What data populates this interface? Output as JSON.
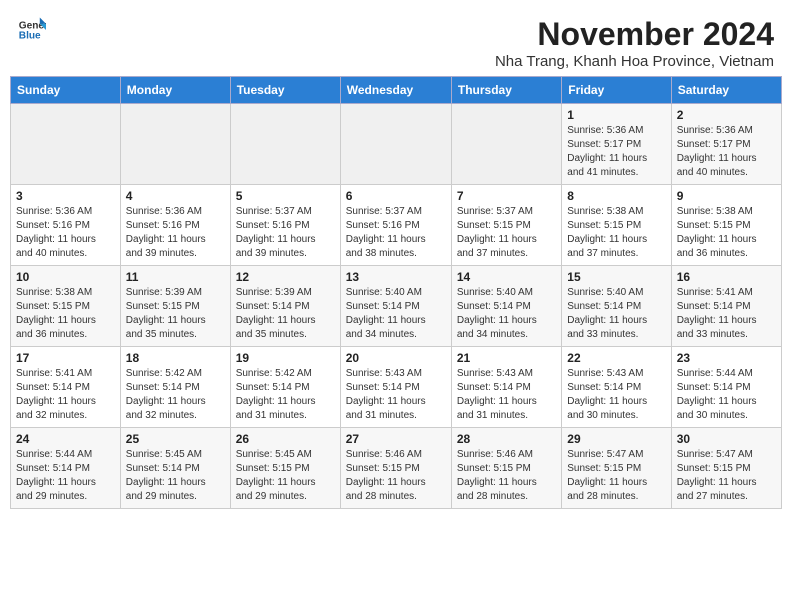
{
  "header": {
    "logo_line1": "General",
    "logo_line2": "Blue",
    "main_title": "November 2024",
    "subtitle": "Nha Trang, Khanh Hoa Province, Vietnam"
  },
  "weekdays": [
    "Sunday",
    "Monday",
    "Tuesday",
    "Wednesday",
    "Thursday",
    "Friday",
    "Saturday"
  ],
  "weeks": [
    [
      {
        "day": "",
        "detail": ""
      },
      {
        "day": "",
        "detail": ""
      },
      {
        "day": "",
        "detail": ""
      },
      {
        "day": "",
        "detail": ""
      },
      {
        "day": "",
        "detail": ""
      },
      {
        "day": "1",
        "detail": "Sunrise: 5:36 AM\nSunset: 5:17 PM\nDaylight: 11 hours\nand 41 minutes."
      },
      {
        "day": "2",
        "detail": "Sunrise: 5:36 AM\nSunset: 5:17 PM\nDaylight: 11 hours\nand 40 minutes."
      }
    ],
    [
      {
        "day": "3",
        "detail": "Sunrise: 5:36 AM\nSunset: 5:16 PM\nDaylight: 11 hours\nand 40 minutes."
      },
      {
        "day": "4",
        "detail": "Sunrise: 5:36 AM\nSunset: 5:16 PM\nDaylight: 11 hours\nand 39 minutes."
      },
      {
        "day": "5",
        "detail": "Sunrise: 5:37 AM\nSunset: 5:16 PM\nDaylight: 11 hours\nand 39 minutes."
      },
      {
        "day": "6",
        "detail": "Sunrise: 5:37 AM\nSunset: 5:16 PM\nDaylight: 11 hours\nand 38 minutes."
      },
      {
        "day": "7",
        "detail": "Sunrise: 5:37 AM\nSunset: 5:15 PM\nDaylight: 11 hours\nand 37 minutes."
      },
      {
        "day": "8",
        "detail": "Sunrise: 5:38 AM\nSunset: 5:15 PM\nDaylight: 11 hours\nand 37 minutes."
      },
      {
        "day": "9",
        "detail": "Sunrise: 5:38 AM\nSunset: 5:15 PM\nDaylight: 11 hours\nand 36 minutes."
      }
    ],
    [
      {
        "day": "10",
        "detail": "Sunrise: 5:38 AM\nSunset: 5:15 PM\nDaylight: 11 hours\nand 36 minutes."
      },
      {
        "day": "11",
        "detail": "Sunrise: 5:39 AM\nSunset: 5:15 PM\nDaylight: 11 hours\nand 35 minutes."
      },
      {
        "day": "12",
        "detail": "Sunrise: 5:39 AM\nSunset: 5:14 PM\nDaylight: 11 hours\nand 35 minutes."
      },
      {
        "day": "13",
        "detail": "Sunrise: 5:40 AM\nSunset: 5:14 PM\nDaylight: 11 hours\nand 34 minutes."
      },
      {
        "day": "14",
        "detail": "Sunrise: 5:40 AM\nSunset: 5:14 PM\nDaylight: 11 hours\nand 34 minutes."
      },
      {
        "day": "15",
        "detail": "Sunrise: 5:40 AM\nSunset: 5:14 PM\nDaylight: 11 hours\nand 33 minutes."
      },
      {
        "day": "16",
        "detail": "Sunrise: 5:41 AM\nSunset: 5:14 PM\nDaylight: 11 hours\nand 33 minutes."
      }
    ],
    [
      {
        "day": "17",
        "detail": "Sunrise: 5:41 AM\nSunset: 5:14 PM\nDaylight: 11 hours\nand 32 minutes."
      },
      {
        "day": "18",
        "detail": "Sunrise: 5:42 AM\nSunset: 5:14 PM\nDaylight: 11 hours\nand 32 minutes."
      },
      {
        "day": "19",
        "detail": "Sunrise: 5:42 AM\nSunset: 5:14 PM\nDaylight: 11 hours\nand 31 minutes."
      },
      {
        "day": "20",
        "detail": "Sunrise: 5:43 AM\nSunset: 5:14 PM\nDaylight: 11 hours\nand 31 minutes."
      },
      {
        "day": "21",
        "detail": "Sunrise: 5:43 AM\nSunset: 5:14 PM\nDaylight: 11 hours\nand 31 minutes."
      },
      {
        "day": "22",
        "detail": "Sunrise: 5:43 AM\nSunset: 5:14 PM\nDaylight: 11 hours\nand 30 minutes."
      },
      {
        "day": "23",
        "detail": "Sunrise: 5:44 AM\nSunset: 5:14 PM\nDaylight: 11 hours\nand 30 minutes."
      }
    ],
    [
      {
        "day": "24",
        "detail": "Sunrise: 5:44 AM\nSunset: 5:14 PM\nDaylight: 11 hours\nand 29 minutes."
      },
      {
        "day": "25",
        "detail": "Sunrise: 5:45 AM\nSunset: 5:14 PM\nDaylight: 11 hours\nand 29 minutes."
      },
      {
        "day": "26",
        "detail": "Sunrise: 5:45 AM\nSunset: 5:15 PM\nDaylight: 11 hours\nand 29 minutes."
      },
      {
        "day": "27",
        "detail": "Sunrise: 5:46 AM\nSunset: 5:15 PM\nDaylight: 11 hours\nand 28 minutes."
      },
      {
        "day": "28",
        "detail": "Sunrise: 5:46 AM\nSunset: 5:15 PM\nDaylight: 11 hours\nand 28 minutes."
      },
      {
        "day": "29",
        "detail": "Sunrise: 5:47 AM\nSunset: 5:15 PM\nDaylight: 11 hours\nand 28 minutes."
      },
      {
        "day": "30",
        "detail": "Sunrise: 5:47 AM\nSunset: 5:15 PM\nDaylight: 11 hours\nand 27 minutes."
      }
    ]
  ]
}
